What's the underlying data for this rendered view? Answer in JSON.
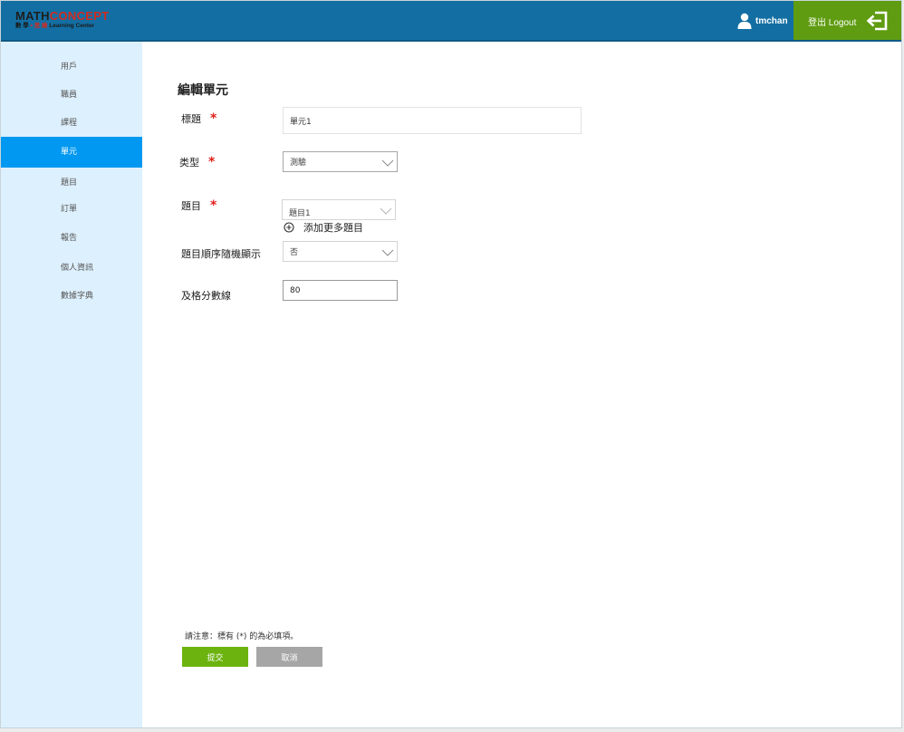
{
  "header": {
    "logo": {
      "math": "MATH",
      "concept": "CONCEPT",
      "line2_black1": "數 學",
      "line2_dot": " • ",
      "line2_red": "思 維",
      "line2_black2": " Learning Center"
    },
    "username": "tmchan",
    "logout_label": "登出 Logout"
  },
  "sidebar": {
    "items": [
      {
        "label": "用戶"
      },
      {
        "label": "職員"
      },
      {
        "label": "課程"
      },
      {
        "label": "單元"
      },
      {
        "label": "題目"
      },
      {
        "label": "訂單"
      },
      {
        "label": "報告"
      },
      {
        "label": "個人資訊"
      },
      {
        "label": "數據字典"
      }
    ],
    "active": "單元"
  },
  "form": {
    "page_title": "編輯單元",
    "required_mark": "*",
    "title": {
      "label": "標題",
      "value": "單元1"
    },
    "type": {
      "label": "类型",
      "value": "測驗"
    },
    "questions": {
      "label": "題目",
      "value": "題目1",
      "add_more": "添加更多題目"
    },
    "random_order": {
      "label": "題目順序隨機顯示",
      "value": "否"
    },
    "pass_score": {
      "label": "及格分數線",
      "value": "80"
    },
    "note": "請注意：標有 (*) 的為必填項。",
    "submit_label": "提交",
    "cancel_label": "取消"
  },
  "colors": {
    "header": "#136fa3",
    "logout": "#5f9c11",
    "sidebar": "#ddf0fd",
    "sidebar_active": "#0098f0",
    "required": "#e0201b",
    "submit": "#6cb30f",
    "cancel": "#a6a6a6"
  },
  "icons": [
    "user-icon",
    "logout-icon",
    "chevron-down-icon",
    "add-circle-icon"
  ]
}
